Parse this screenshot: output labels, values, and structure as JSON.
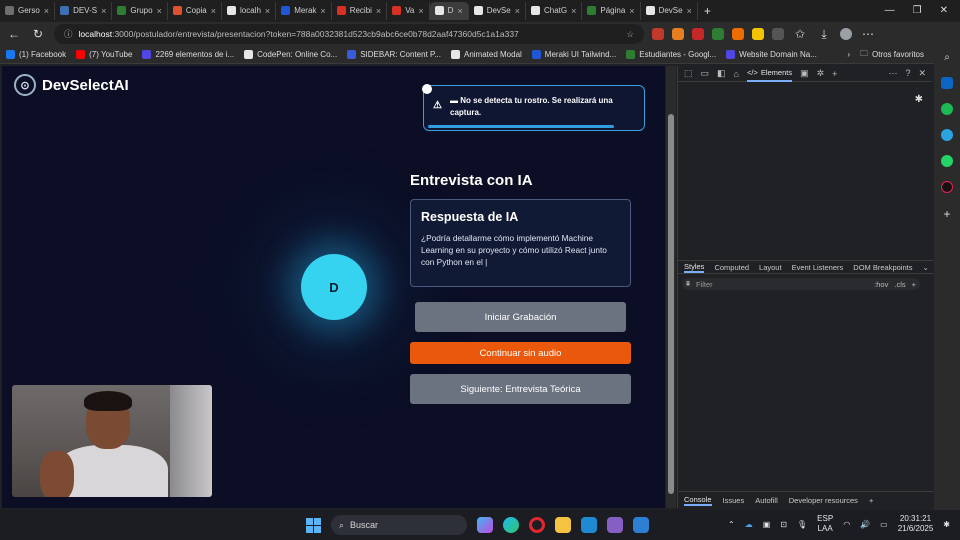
{
  "browser": {
    "tabs": [
      {
        "label": "Gerso",
        "color": "#6e6e6e"
      },
      {
        "label": "DEV-S",
        "color": "#3b6fb6"
      },
      {
        "label": "Grupo",
        "color": "#2e7d32"
      },
      {
        "label": "Copia",
        "color": "#e0522f"
      },
      {
        "label": "localh",
        "color": "#e6e6e6"
      },
      {
        "label": "Merak",
        "color": "#1f57d6"
      },
      {
        "label": "Recibi",
        "color": "#d93025"
      },
      {
        "label": "Va",
        "color": "#d93025"
      },
      {
        "label": "D",
        "color": "#e6e6e6",
        "active": true
      },
      {
        "label": "DevSe",
        "color": "#e6e6e6"
      },
      {
        "label": "ChatG",
        "color": "#e6e6e6"
      },
      {
        "label": "Página",
        "color": "#2e7d32"
      },
      {
        "label": "DevSe",
        "color": "#e6e6e6"
      }
    ],
    "url_host": "localhost",
    "url_path": ":3000/postulador/entrevista/presentacion?token=788a0032381d523cb9abc6ce0b78d2aaf47360d5c1a1a337",
    "bookmarks": [
      {
        "label": "(1) Facebook",
        "color": "#1877f2"
      },
      {
        "label": "(7) YouTube",
        "color": "#ff0000"
      },
      {
        "label": "2269 elementos de i...",
        "color": "#4f46e5"
      },
      {
        "label": "CodePen: Online Co...",
        "color": "#e6e6e6"
      },
      {
        "label": "SIDEBAR: Content P...",
        "color": "#3b5bdb"
      },
      {
        "label": "Animated Modal",
        "color": "#e6e6e6"
      },
      {
        "label": "Meraki UI Tailwind...",
        "color": "#1f57d6"
      },
      {
        "label": "Estudiantes - Googl...",
        "color": "#2e7d32"
      },
      {
        "label": "Website Domain Na...",
        "color": "#4f46e5"
      }
    ],
    "other_bookmarks": "Otros favoritos"
  },
  "app": {
    "brand": "DevSelectAI",
    "toast_text": "No se detecta tu rostro. Se realizará una captura.",
    "avatar_letter": "D",
    "section_title": "Entrevista con IA",
    "response_title": "Respuesta de IA",
    "response_text": "¿Podría detallarme cómo implementó Machine Learning en su proyecto y cómo utilizó React junto con Python en el |",
    "btn_record": "Iniciar Grabación",
    "btn_no_audio": "Continuar sin audio",
    "btn_next": "Siguiente: Entrevista Teórica",
    "colors": {
      "accent_orange": "#ea580c",
      "orb": "#35d3ef",
      "bg": "#0b0e24"
    }
  },
  "devtools": {
    "active_tab": "Elements",
    "style_tabs": [
      "Styles",
      "Computed",
      "Layout",
      "Event Listeners",
      "DOM Breakpoints"
    ],
    "filter_placeholder": "Filter",
    "filter_hov": ":hov",
    "filter_cls": ".cls",
    "bottom_tabs": [
      "Console",
      "Issues",
      "Autofill",
      "Developer resources"
    ]
  },
  "taskbar": {
    "search": "Buscar",
    "lang_top": "ESP",
    "lang_bottom": "LAA",
    "time": "20:31:21",
    "date": "21/6/2025"
  }
}
